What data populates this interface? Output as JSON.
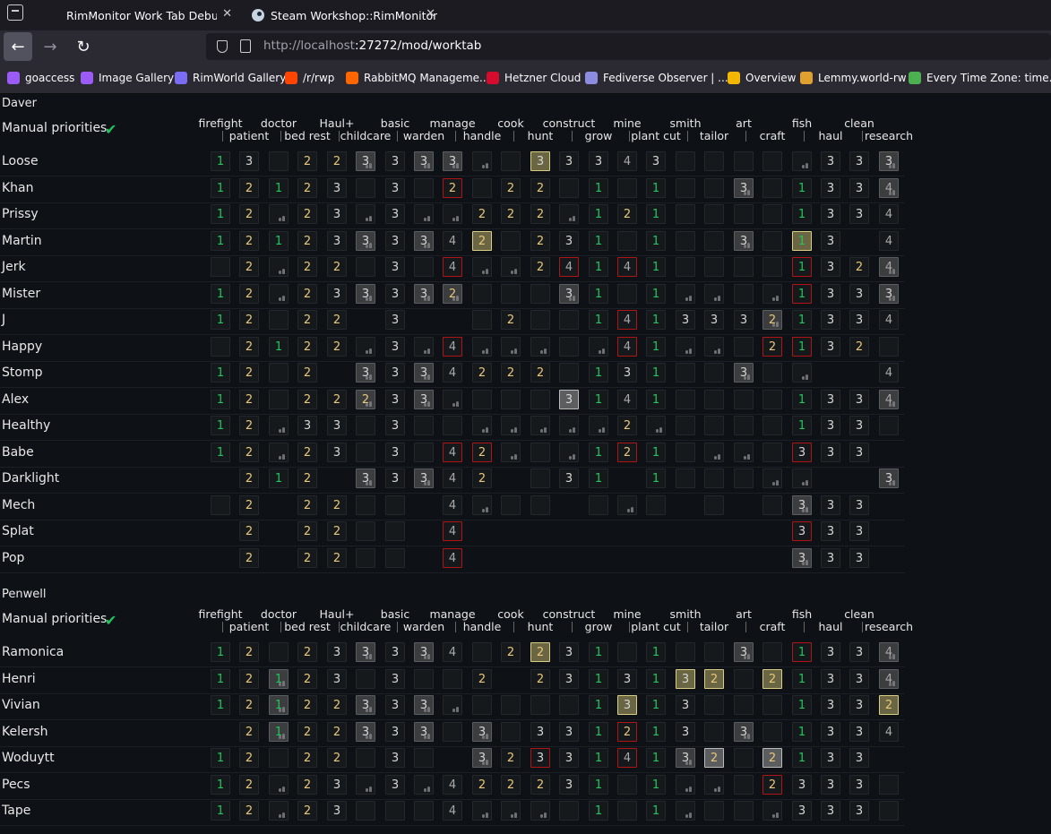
{
  "browser": {
    "tabs": [
      {
        "title": "RimMonitor Work Tab Debugging"
      },
      {
        "title": "Steam Workshop::RimMonitor"
      }
    ],
    "url": {
      "host": "http://localhost",
      "rest": ":27272/mod/worktab"
    },
    "bookmarks": [
      {
        "label": "goaccess",
        "icon": "vs-icon",
        "color": "#9a5cf5"
      },
      {
        "label": "Image Gallery",
        "icon": "vs-icon",
        "color": "#9a5cf5"
      },
      {
        "label": "RimWorld Gallery",
        "icon": "triangle-icon",
        "color": "#7a6cf5"
      },
      {
        "label": "/r/rwp",
        "icon": "reddit-icon",
        "color": "#ff4500"
      },
      {
        "label": "RabbitMQ Manageme...",
        "icon": "rabbitmq-icon",
        "color": "#ff6600"
      },
      {
        "label": "Hetzner Cloud",
        "icon": "hetzner-icon",
        "color": "#d50c2d"
      },
      {
        "label": "Fediverse Observer | ...",
        "icon": "fediverse-icon",
        "color": "#8c8ce0"
      },
      {
        "label": "Overview",
        "icon": "chart-icon",
        "color": "#f2b705"
      },
      {
        "label": "Lemmy.world-rw",
        "icon": "grafana-icon",
        "color": "#e0a030"
      },
      {
        "label": "Every Time Zone: time...",
        "icon": "clock-icon",
        "color": "#4caf50"
      }
    ]
  },
  "work_types": [
    {
      "label": "firefight",
      "row": "top"
    },
    {
      "label": "patient",
      "row": "bottom"
    },
    {
      "label": "doctor",
      "row": "top"
    },
    {
      "label": "bed rest",
      "row": "bottom"
    },
    {
      "label": "Haul+",
      "row": "top"
    },
    {
      "label": "childcare",
      "row": "bottom"
    },
    {
      "label": "basic",
      "row": "top"
    },
    {
      "label": "warden",
      "row": "bottom"
    },
    {
      "label": "manage",
      "row": "top"
    },
    {
      "label": "handle",
      "row": "bottom"
    },
    {
      "label": "cook",
      "row": "top"
    },
    {
      "label": "hunt",
      "row": "bottom"
    },
    {
      "label": "construct",
      "row": "top"
    },
    {
      "label": "grow",
      "row": "bottom"
    },
    {
      "label": "mine",
      "row": "top"
    },
    {
      "label": "plant cut",
      "row": "bottom"
    },
    {
      "label": "smith",
      "row": "top"
    },
    {
      "label": "tailor",
      "row": "bottom"
    },
    {
      "label": "art",
      "row": "top"
    },
    {
      "label": "craft",
      "row": "bottom"
    },
    {
      "label": "fish",
      "row": "top"
    },
    {
      "label": "haul",
      "row": "bottom"
    },
    {
      "label": "clean",
      "row": "top"
    },
    {
      "label": "research",
      "row": "bottom"
    }
  ],
  "manual_priorities_label": "Manual priorities",
  "groups": [
    {
      "name": "Daver",
      "pawns": [
        {
          "name": "Loose",
          "cells": [
            "1",
            "3",
            ".",
            "2",
            "2",
            "3s",
            "3",
            "3s",
            "3s",
            "s",
            ".",
            "3g",
            "3",
            "3",
            "4",
            "3",
            ".",
            ".",
            ".",
            ".",
            "s",
            "3",
            "3",
            "3s"
          ]
        },
        {
          "name": "Khan",
          "cells": [
            "1",
            "2",
            "1",
            "2",
            "3",
            ".",
            "3",
            ".",
            "2r",
            ".",
            "2",
            "2",
            ".",
            "1",
            ".",
            "1",
            ".",
            ".",
            "3s",
            ".",
            "1",
            "3",
            "3",
            "4s"
          ]
        },
        {
          "name": "Prissy",
          "cells": [
            "1",
            "2",
            "s",
            "2",
            "3",
            "s",
            "3",
            "s",
            "s",
            "2",
            "2",
            "2",
            "s",
            "1",
            "2",
            "1",
            ".",
            ".",
            ".",
            ".",
            "1",
            "3",
            "3",
            "4"
          ]
        },
        {
          "name": "Martin",
          "cells": [
            "1",
            "2",
            "1",
            "2",
            "3",
            "3s",
            "3",
            "3s",
            "4",
            "2g",
            ".",
            "2",
            "3",
            "1",
            ".",
            "1",
            ".",
            ".",
            "3s",
            ".",
            "1g",
            "3",
            "_",
            "4"
          ]
        },
        {
          "name": "Jerk",
          "cells": [
            ".",
            "2",
            "s",
            "2",
            "2",
            ".",
            "3",
            ".",
            "4r",
            "s",
            "s",
            "2",
            "4r",
            "1",
            "4r",
            "1",
            ".",
            ".",
            ".",
            ".",
            "1r",
            "3",
            "2",
            "4s"
          ]
        },
        {
          "name": "Mister",
          "cells": [
            "1",
            "2",
            "s",
            "2",
            "3",
            "3s",
            "3",
            "3s",
            "2s",
            ".",
            ".",
            ".",
            "3s",
            "1",
            ".",
            "1",
            "s",
            "s",
            ".",
            "s",
            "1r",
            "3",
            "3",
            "3s"
          ]
        },
        {
          "name": "J",
          "cells": [
            "1",
            "2",
            ".",
            "2",
            "2",
            "_",
            "3",
            "_",
            "_",
            ".",
            "2",
            ".",
            ".",
            "1",
            "4r",
            "1",
            "3",
            "3",
            "3",
            "2s",
            "1",
            "3",
            "3",
            "4"
          ]
        },
        {
          "name": "Happy",
          "cells": [
            ".",
            "2",
            "1",
            "2",
            "2",
            "s",
            "3",
            "s",
            "4r",
            "s",
            "s",
            "s",
            ".",
            "s",
            "4r",
            "1",
            "s",
            "s",
            ".",
            "2r",
            "1r",
            "3",
            "2",
            "."
          ]
        },
        {
          "name": "Stomp",
          "cells": [
            "1",
            "2",
            ".",
            "2",
            "_",
            "3s",
            "3",
            "3s",
            "4",
            "2",
            "2",
            "2",
            ".",
            "1",
            "3",
            "1",
            ".",
            ".",
            "3s",
            ".",
            "s",
            "_",
            "_",
            "4"
          ]
        },
        {
          "name": "Alex",
          "cells": [
            "1",
            "2",
            ".",
            "2",
            "2",
            "2s",
            "3",
            "3s",
            "s",
            ".",
            ".",
            ".",
            "3h",
            "1",
            "4",
            "1",
            ".",
            ".",
            ".",
            ".",
            "1",
            "3",
            "3",
            "4s"
          ]
        },
        {
          "name": "Healthy",
          "cells": [
            "1",
            "2",
            "s",
            "3",
            "3",
            ".",
            "3",
            ".",
            ".",
            "s",
            "s",
            "s",
            "s",
            "s",
            "2",
            "s",
            ".",
            ".",
            ".",
            ".",
            "1",
            "3",
            "3",
            "."
          ]
        },
        {
          "name": "Babe",
          "cells": [
            "1",
            "2",
            "s",
            "2",
            "3",
            ".",
            "3",
            ".",
            "4r",
            "2r",
            "s",
            ".",
            "s",
            "1",
            "2r",
            "1",
            ".",
            "s",
            "s",
            ".",
            "3r",
            "3",
            "3",
            "_"
          ]
        },
        {
          "name": "Darklight",
          "cells": [
            "_",
            "2",
            "1",
            "2",
            "_",
            "3s",
            "3",
            "3s",
            "4",
            "2",
            "_",
            ".",
            "3",
            "1",
            "_",
            "1",
            ".",
            ".",
            ".",
            "s",
            "s",
            "_",
            "_",
            "3s"
          ]
        },
        {
          "name": "Mech",
          "cells": [
            ".",
            "2",
            "_",
            "2",
            "2",
            ".",
            ".",
            "_",
            "4",
            "s",
            ".",
            ".",
            "_",
            ".",
            "s",
            ".",
            "_",
            ".",
            "_",
            ".",
            "3s",
            "3",
            "3",
            "_"
          ]
        },
        {
          "name": "Splat",
          "cells": [
            "_",
            "2",
            "_",
            "2",
            "2",
            ".",
            ".",
            "_",
            "4r",
            "_",
            "_",
            "_",
            "_",
            "_",
            "_",
            "_",
            "_",
            "_",
            "_",
            "_",
            "3r",
            "3",
            "3",
            "_"
          ]
        },
        {
          "name": "Pop",
          "cells": [
            "_",
            "2",
            "_",
            "2",
            "2",
            ".",
            ".",
            "_",
            "4r",
            "_",
            "_",
            "_",
            "_",
            "_",
            "_",
            "_",
            "_",
            "_",
            "_",
            "_",
            "3s",
            "3",
            "3",
            "_"
          ]
        }
      ]
    },
    {
      "name": "Penwell",
      "pawns": [
        {
          "name": "Ramonica",
          "cells": [
            "1",
            "2",
            ".",
            "2",
            "3",
            "3s",
            "3",
            "3s",
            "4",
            ".",
            "2",
            "2g",
            "3",
            "1",
            ".",
            "1",
            ".",
            ".",
            "3s",
            ".",
            "1r",
            "3",
            "3",
            "4s"
          ]
        },
        {
          "name": "Henri",
          "cells": [
            "1",
            "2",
            "1s",
            "2",
            "3",
            ".",
            "3",
            ".",
            ".",
            "2",
            "_",
            "2",
            "3",
            "1",
            "3",
            "1",
            "3g",
            "2g",
            ".",
            "2g",
            "1",
            "3",
            "3",
            "4s"
          ]
        },
        {
          "name": "Vivian",
          "cells": [
            "1",
            "2",
            "1s",
            "2",
            "2",
            "3s",
            "3",
            "3s",
            "s",
            ".",
            ".",
            ".",
            ".",
            "1",
            "3g",
            "1",
            "3",
            ".",
            ".",
            ".",
            "1",
            "3",
            "3",
            "2g"
          ]
        },
        {
          "name": "Kelersh",
          "cells": [
            "_",
            "2",
            "1s",
            "2",
            "2",
            "3s",
            "3",
            "3s",
            ".",
            "3s",
            ".",
            "3",
            "3",
            "1",
            "2r",
            "1",
            "3",
            ".",
            "3s",
            ".",
            "1",
            "3",
            "3",
            "4"
          ]
        },
        {
          "name": "Woduytt",
          "cells": [
            "1",
            "2",
            ".",
            "2",
            "2",
            ".",
            "3",
            ".",
            "_",
            "3s",
            "2",
            "3r",
            "3",
            "1",
            "4r",
            "1",
            "3s",
            "2h",
            ".",
            "2h",
            "1",
            "3",
            "3",
            "_"
          ]
        },
        {
          "name": "Pecs",
          "cells": [
            "1",
            "2",
            "s",
            "2",
            "3",
            "s",
            "3",
            "s",
            "4",
            "2",
            "2",
            "2",
            "3",
            "1",
            ".",
            "1",
            "s",
            "s",
            ".",
            "2r",
            "3",
            "3",
            "3",
            "."
          ]
        },
        {
          "name": "Tape",
          "cells": [
            "1",
            "2",
            "s",
            "2",
            "3",
            ".",
            ".",
            ".",
            "4",
            "s",
            "s",
            "s",
            ".",
            "1",
            ".",
            "1",
            "s",
            ".",
            ".",
            "s",
            "3",
            "3",
            "3",
            "."
          ]
        }
      ]
    }
  ],
  "colors": {
    "p1": "#22c55e",
    "p2": "#e8c87a",
    "p3": "#d6d6d6",
    "p4": "#a8a8a8",
    "selected_border": "#b01515"
  }
}
